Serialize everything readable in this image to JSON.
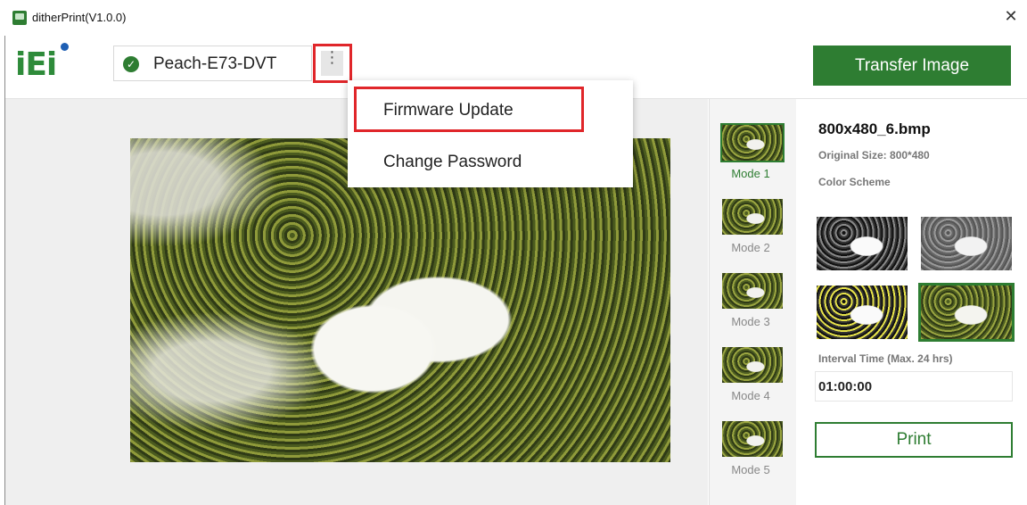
{
  "window": {
    "title": "ditherPrint(V1.0.0)",
    "close_glyph": "✕"
  },
  "logo": {
    "text": "iEi",
    "color": "#2e8b3a",
    "dot_color": "#1e5fb4"
  },
  "device": {
    "name": "Peach-E73-DVT",
    "status_icon": "check-circle-icon",
    "kebab_glyph": "⋮"
  },
  "toolbar": {
    "transfer_label": "Transfer Image"
  },
  "menu": {
    "items": [
      {
        "label": "Firmware Update"
      },
      {
        "label": "Change Password"
      }
    ]
  },
  "modes": [
    {
      "label": "Mode 1",
      "selected": true
    },
    {
      "label": "Mode 2"
    },
    {
      "label": "Mode 3"
    },
    {
      "label": "Mode 4"
    },
    {
      "label": "Mode 5"
    }
  ],
  "details": {
    "file_name": "800x480_6.bmp",
    "original_size": "Original Size: 800*480",
    "color_scheme_label": "Color Scheme",
    "interval_label": "Interval Time (Max. 24 hrs)",
    "interval_value": "01:00:00",
    "print_label": "Print"
  },
  "colors": {
    "accent": "#2e7d32",
    "highlight": "#e0262a"
  }
}
